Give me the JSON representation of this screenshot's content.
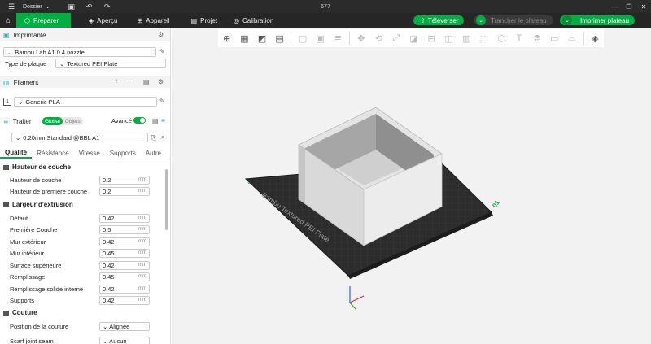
{
  "titlebar": {
    "menu_label": "Dossier",
    "title": "677",
    "icons": [
      "menu-icon",
      "save-icon",
      "undo-icon",
      "redo-icon"
    ],
    "window_controls": [
      "minimize-icon",
      "restore-icon",
      "close-icon"
    ]
  },
  "navbar": {
    "tabs": [
      {
        "label": "Préparer",
        "icon": "cube-icon",
        "active": true
      },
      {
        "label": "Aperçu",
        "icon": "layers-icon"
      },
      {
        "label": "Appareil",
        "icon": "device-icon"
      },
      {
        "label": "Projet",
        "icon": "project-icon"
      },
      {
        "label": "Calibration",
        "icon": "calibration-icon"
      }
    ],
    "upload_label": "Téléverser",
    "slice_label": "Trancher le plateau",
    "print_label": "Imprimer plateau",
    "accent": "#00ae42"
  },
  "sidebar": {
    "printer": {
      "header": "Imprimante",
      "printer_name": "Bambu Lab A1 0.4 nozzle",
      "plate_label": "Type de plaque",
      "plate_value": "Textured PEI Plate"
    },
    "filament": {
      "header": "Filament",
      "slot_number": "1",
      "filament_name": "Generic PLA"
    },
    "process": {
      "header": "Traiter",
      "mode_global": "Global",
      "mode_objects": "Objets",
      "advanced_label": "Avancé",
      "advanced_on": true,
      "preset": "0.20mm Standard @BBL A1"
    },
    "tabs": [
      "Qualité",
      "Résistance",
      "Vitesse",
      "Supports",
      "Autre"
    ],
    "groups": {
      "layer_height": {
        "title": "Hauteur de couche",
        "rows": [
          {
            "label": "Hauteur de couche",
            "value": "0,2",
            "unit": "mm"
          },
          {
            "label": "Hauteur de première couche",
            "value": "0,2",
            "unit": "mm"
          }
        ]
      },
      "line_width": {
        "title": "Largeur d'extrusion",
        "rows": [
          {
            "label": "Défaut",
            "value": "0,42",
            "unit": "mm"
          },
          {
            "label": "Première Couche",
            "value": "0,5",
            "unit": "mm"
          },
          {
            "label": "Mur extérieur",
            "value": "0,42",
            "unit": "mm"
          },
          {
            "label": "Mur intérieur",
            "value": "0,45",
            "unit": "mm"
          },
          {
            "label": "Surface supérieure",
            "value": "0,42",
            "unit": "mm"
          },
          {
            "label": "Remplissage",
            "value": "0,45",
            "unit": "mm"
          },
          {
            "label": "Remplissage solide interne",
            "value": "0,42",
            "unit": "mm"
          },
          {
            "label": "Supports",
            "value": "0,42",
            "unit": "mm"
          }
        ]
      },
      "seam": {
        "title": "Couture",
        "rows": [
          {
            "label": "Position de la couture",
            "value": "Alignée"
          },
          {
            "label": "Scarf joint seam",
            "value": "Aucun"
          }
        ]
      }
    }
  },
  "viewport": {
    "plate_text": "Bambu Textured PEI Plate",
    "plate_number": "01",
    "background": "#f2f2f2",
    "toolbar_icons": [
      "add-object-icon",
      "arrange-grid-icon",
      "orient-icon",
      "plate-settings-icon",
      "paste-icon",
      "copy-icon",
      "layers-icon",
      "move-icon",
      "rotate-icon",
      "scale-icon",
      "lay-on-face-icon",
      "cut-icon",
      "split-objects-icon",
      "split-parts-icon",
      "support-paint-icon",
      "seam-paint-icon",
      "text-icon",
      "color-paint-icon",
      "measure-icon",
      "assembly-icon",
      "view-icon"
    ]
  }
}
